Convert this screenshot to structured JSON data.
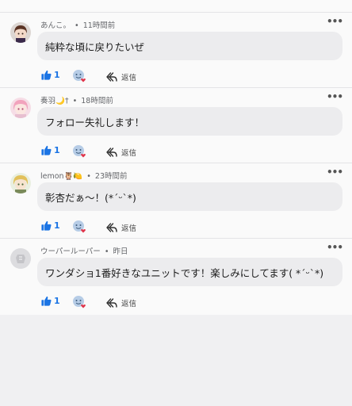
{
  "comments": [
    {
      "author": "あんこ。",
      "time": "11時間前",
      "text": "純粋な頃に戻りたいぜ",
      "like_count": "1",
      "reply_label": "返信",
      "avatar_icon": "user-avatar-brown-hair"
    },
    {
      "author": "奏羽🌙†",
      "time": "18時間前",
      "text": "フォロー失礼します！",
      "like_count": "1",
      "reply_label": "返信",
      "avatar_icon": "user-avatar-pink-hair"
    },
    {
      "author": "lemon🦉🍋",
      "time": "23時間前",
      "text": "彰杏だぁ〜！(*´ᵕ`*)",
      "like_count": "1",
      "reply_label": "返信",
      "avatar_icon": "user-avatar-blonde-hair"
    },
    {
      "author": "ウーパールーパー",
      "time": "昨日",
      "text": "ワンダショ1番好きなユニットです！楽しみにしてます( *´ᵕ`*)",
      "like_count": "1",
      "reply_label": "返信",
      "avatar_icon": "user-avatar-placeholder"
    }
  ],
  "separator": "•",
  "more_icon": "ellipsis-icon",
  "colors": {
    "accent": "#1b74e4",
    "bubble": "#ececee",
    "background": "#f0f0f2",
    "meta_text": "#65676b",
    "heart": "#e0354b"
  }
}
